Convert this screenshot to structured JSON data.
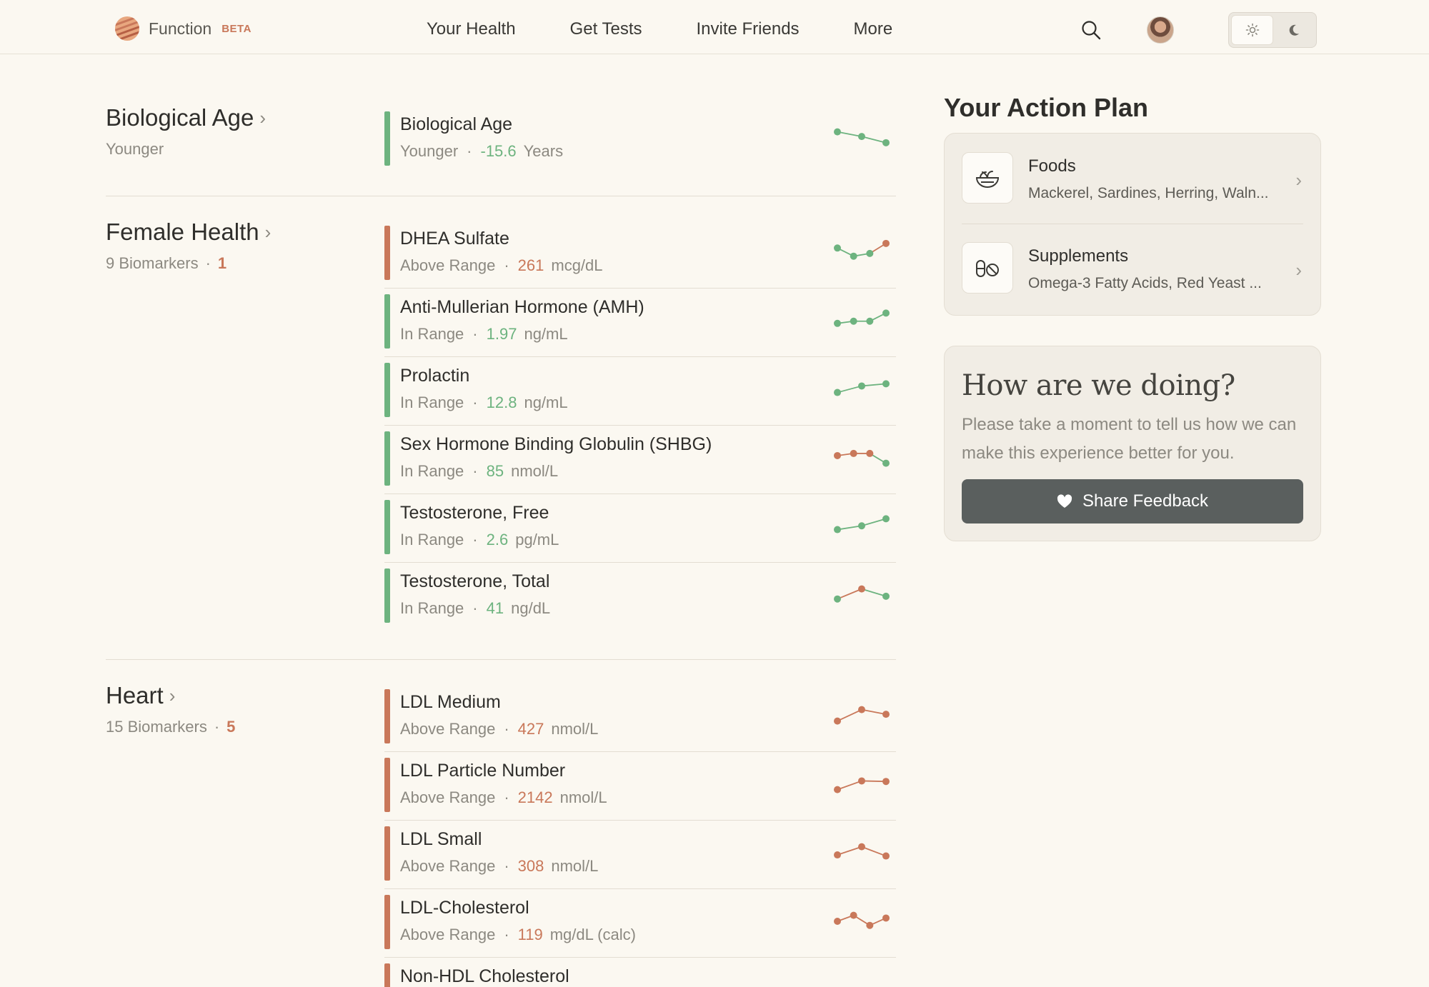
{
  "app": {
    "logo_text": "Function",
    "logo_badge": "BETA"
  },
  "nav": {
    "items": [
      {
        "label": "Your Health"
      },
      {
        "label": "Get Tests"
      },
      {
        "label": "Invite Friends"
      },
      {
        "label": "More"
      }
    ]
  },
  "header_icons": [
    "search-icon",
    "avatar",
    "sun-icon",
    "moon-icon"
  ],
  "colors": {
    "in_range": "#6db37f",
    "above_range": "#c9785a",
    "background": "#fbf8f1",
    "button": "#5a5f5e"
  },
  "sections": [
    {
      "title": "Biological Age",
      "subtitle": "Younger",
      "count": "",
      "rows": [
        {
          "name": "Biological Age",
          "status": "Younger",
          "value": "-15.6",
          "unit": "Years",
          "color": "#6db37f",
          "spark": [
            0.72,
            0.55,
            0.32
          ],
          "spark_colors": [
            "#6db37f",
            "#6db37f",
            "#6db37f"
          ]
        }
      ]
    },
    {
      "title": "Female Health",
      "subtitle": "9 Biomarkers",
      "count": "1",
      "rows": [
        {
          "name": "DHEA Sulfate",
          "status": "Above Range",
          "value": "261",
          "unit": "mcg/dL",
          "color": "#c9785a",
          "spark": [
            0.65,
            0.35,
            0.45,
            0.82
          ],
          "spark_colors": [
            "#6db37f",
            "#6db37f",
            "#6db37f",
            "#c9785a"
          ]
        },
        {
          "name": "Anti-Mullerian Hormone (AMH)",
          "status": "In Range",
          "value": "1.97",
          "unit": "ng/mL",
          "color": "#6db37f",
          "spark": [
            0.4,
            0.48,
            0.48,
            0.78
          ],
          "spark_colors": [
            "#6db37f",
            "#6db37f",
            "#6db37f",
            "#6db37f"
          ]
        },
        {
          "name": "Prolactin",
          "status": "In Range",
          "value": "12.8",
          "unit": "ng/mL",
          "color": "#6db37f",
          "spark": [
            0.38,
            0.62,
            0.7
          ],
          "spark_colors": [
            "#6db37f",
            "#6db37f",
            "#6db37f"
          ]
        },
        {
          "name": "Sex Hormone Binding Globulin (SHBG)",
          "status": "In Range",
          "value": "85",
          "unit": "nmol/L",
          "color": "#6db37f",
          "spark": [
            0.58,
            0.66,
            0.66,
            0.3
          ],
          "spark_colors": [
            "#c9785a",
            "#c9785a",
            "#c9785a",
            "#6db37f"
          ]
        },
        {
          "name": "Testosterone, Free",
          "status": "In Range",
          "value": "2.6",
          "unit": "pg/mL",
          "color": "#6db37f",
          "spark": [
            0.38,
            0.52,
            0.78
          ],
          "spark_colors": [
            "#6db37f",
            "#6db37f",
            "#6db37f"
          ]
        },
        {
          "name": "Testosterone, Total",
          "status": "In Range",
          "value": "41",
          "unit": "ng/dL",
          "color": "#6db37f",
          "spark": [
            0.35,
            0.72,
            0.45
          ],
          "spark_colors": [
            "#6db37f",
            "#c9785a",
            "#6db37f"
          ]
        }
      ]
    },
    {
      "title": "Heart",
      "subtitle": "15 Biomarkers",
      "count": "5",
      "rows": [
        {
          "name": "LDL Medium",
          "status": "Above Range",
          "value": "427",
          "unit": "nmol/L",
          "color": "#c9785a",
          "spark": [
            0.3,
            0.72,
            0.55
          ],
          "spark_colors": [
            "#c9785a",
            "#c9785a",
            "#c9785a"
          ]
        },
        {
          "name": "LDL Particle Number",
          "status": "Above Range",
          "value": "2142",
          "unit": "nmol/L",
          "color": "#c9785a",
          "spark": [
            0.3,
            0.62,
            0.6
          ],
          "spark_colors": [
            "#c9785a",
            "#c9785a",
            "#c9785a"
          ]
        },
        {
          "name": "LDL Small",
          "status": "Above Range",
          "value": "308",
          "unit": "nmol/L",
          "color": "#c9785a",
          "spark": [
            0.42,
            0.72,
            0.38
          ],
          "spark_colors": [
            "#c9785a",
            "#c9785a",
            "#c9785a"
          ]
        },
        {
          "name": "LDL-Cholesterol",
          "status": "Above Range",
          "value": "119",
          "unit": "mg/dL (calc)",
          "color": "#c9785a",
          "spark": [
            0.5,
            0.72,
            0.35,
            0.62
          ],
          "spark_colors": [
            "#c9785a",
            "#c9785a",
            "#c9785a",
            "#c9785a"
          ]
        },
        {
          "name": "Non-HDL Cholesterol",
          "status": "",
          "value": "",
          "unit": "",
          "color": "#c9785a",
          "spark": [],
          "spark_colors": []
        }
      ]
    }
  ],
  "action_plan": {
    "title": "Your Action Plan",
    "items": [
      {
        "name": "Foods",
        "desc": "Mackerel, Sardines, Herring, Waln...",
        "icon": "bowl-icon"
      },
      {
        "name": "Supplements",
        "desc": "Omega-3 Fatty Acids, Red Yeast ...",
        "icon": "pills-icon"
      }
    ]
  },
  "feedback": {
    "title": "How are we doing?",
    "text": "Please take a moment to tell us how we can make this experience better for you.",
    "button_label": "Share Feedback",
    "button_icon": "heart-icon"
  }
}
